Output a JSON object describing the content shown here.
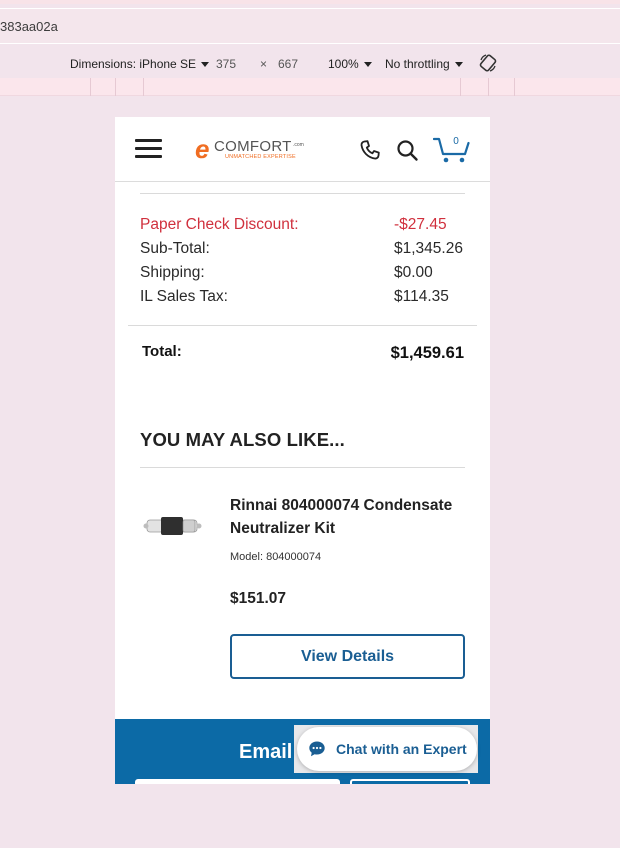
{
  "devtools": {
    "url_fragment": "383aa02a",
    "dimensions_label": "Dimensions: iPhone SE",
    "width": "375",
    "times": "×",
    "height": "667",
    "zoom": "100%",
    "throttling": "No throttling"
  },
  "header": {
    "logo_e": "e",
    "logo_word": "COMFORT",
    "logo_com": ".com",
    "logo_tagline": "UNMATCHED EXPERTISE",
    "cart_count": "0",
    "icons": [
      "menu-icon",
      "phone-icon",
      "search-icon",
      "cart-icon"
    ]
  },
  "summary": {
    "discount_label": "Paper Check Discount:",
    "discount_value": "-$27.45",
    "subtotal_label": "Sub-Total:",
    "subtotal_value": "$1,345.26",
    "shipping_label": "Shipping:",
    "shipping_value": "$0.00",
    "tax_label": "IL Sales Tax:",
    "tax_value": "$114.35",
    "total_label": "Total:",
    "total_value": "$1,459.61"
  },
  "recommendations": {
    "heading": "YOU MAY ALSO LIKE...",
    "product": {
      "name": "Rinnai 804000074 Condensate Neutralizer Kit",
      "model": "Model: 804000074",
      "price": "$151.07",
      "button_label": "View Details"
    }
  },
  "footer": {
    "title": "Email"
  },
  "chat": {
    "label": "Chat with an Expert"
  },
  "colors": {
    "discount": "#d0303d",
    "brand_orange": "#f06d22",
    "brand_blue": "#1a5e93",
    "footer_blue": "#0c6aa6",
    "page_bg": "#f2e4ec"
  }
}
